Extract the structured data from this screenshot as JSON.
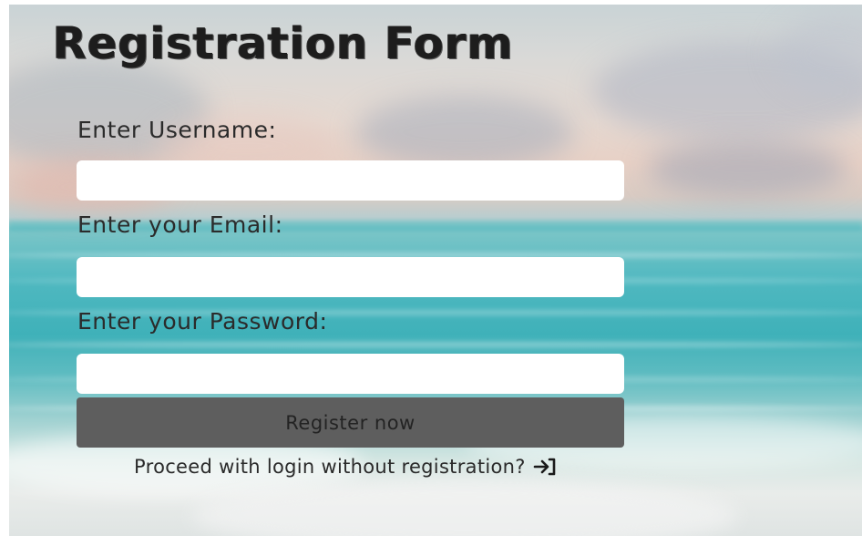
{
  "form": {
    "title": "Registration Form",
    "username_label": "Enter Username:",
    "email_label": "Enter your Email:",
    "password_label": "Enter your Password:",
    "username_value": "",
    "email_value": "",
    "password_value": "",
    "submit_label": "Register now",
    "login_link_label": "Proceed with login without registration?",
    "login_icon": "login-arrow-icon"
  },
  "colors": {
    "button_bg": "#5e5e5e",
    "input_bg": "#ffffff",
    "text": "#2b2b2b"
  }
}
